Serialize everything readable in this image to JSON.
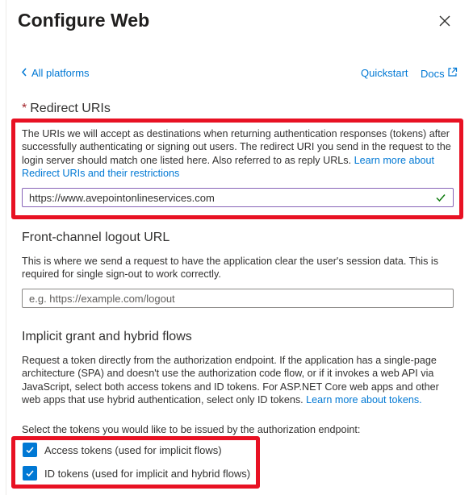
{
  "panel": {
    "title": "Configure Web",
    "back_label": "All platforms",
    "quickstart_label": "Quickstart",
    "docs_label": "Docs"
  },
  "redirect": {
    "required_mark": "*",
    "heading": "Redirect URIs",
    "description": "The URIs we will accept as destinations when returning authentication responses (tokens) after successfully authenticating or signing out users. The redirect URI you send in the request to the login server should match one listed here. Also referred to as reply URLs.",
    "link_text": "Learn more about Redirect URIs and their restrictions",
    "uri_value": "https://www.avepointonlineservices.com"
  },
  "logout": {
    "heading": "Front-channel logout URL",
    "description": "This is where we send a request to have the application clear the user's session data. This is required for single sign-out to work correctly.",
    "placeholder": "e.g. https://example.com/logout"
  },
  "implicit": {
    "heading": "Implicit grant and hybrid flows",
    "description": "Request a token directly from the authorization endpoint. If the application has a single-page architecture (SPA) and doesn't use the authorization code flow, or if it invokes a web API via JavaScript, select both access tokens and ID tokens. For ASP.NET Core web apps and other web apps that use hybrid authentication, select only ID tokens.",
    "link_text": "Learn more about tokens.",
    "prompt": "Select the tokens you would like to be issued by the authorization endpoint:",
    "access_tokens_label": "Access tokens (used for implicit flows)",
    "access_tokens_checked": true,
    "id_tokens_label": "ID tokens (used for implicit and hybrid flows)",
    "id_tokens_checked": true
  },
  "colors": {
    "link": "#0078d4",
    "highlight": "#e81123",
    "checkbox": "#0078d4",
    "valid": "#107c10"
  }
}
